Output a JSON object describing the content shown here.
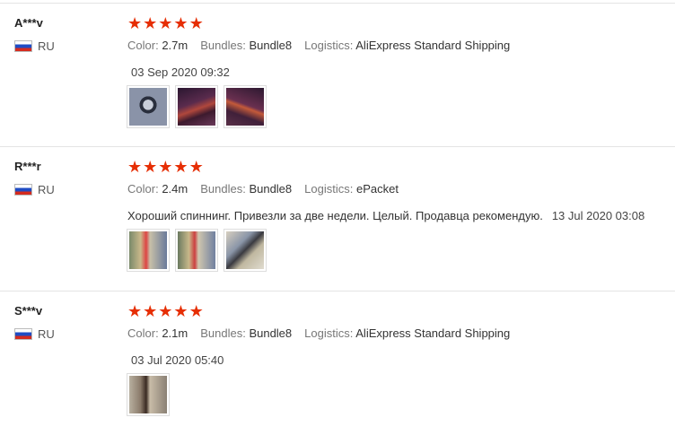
{
  "labels": {
    "color": "Color:",
    "bundles": "Bundles:",
    "logistics": "Logistics:"
  },
  "reviews": [
    {
      "user": "A***v",
      "country": "RU",
      "rating": 5,
      "color": "2.7m",
      "bundles": "Bundle8",
      "logistics": "AliExpress Standard Shipping",
      "text": "",
      "date": "03 Sep 2020 09:32",
      "photos": 3
    },
    {
      "user": "R***r",
      "country": "RU",
      "rating": 5,
      "color": "2.4m",
      "bundles": "Bundle8",
      "logistics": "ePacket",
      "text": "Хороший спиннинг. Привезли за две недели. Целый. Продавца рекомендую.",
      "date": "13 Jul 2020 03:08",
      "photos": 3
    },
    {
      "user": "S***v",
      "country": "RU",
      "rating": 5,
      "color": "2.1m",
      "bundles": "Bundle8",
      "logistics": "AliExpress Standard Shipping",
      "text": "",
      "date": "03 Jul 2020 05:40",
      "photos": 1
    }
  ],
  "colors": {
    "star": "#e62e04",
    "divider": "#e4e4e4"
  },
  "icons": {
    "star": "star-icon",
    "flag": "russia-flag-icon"
  }
}
